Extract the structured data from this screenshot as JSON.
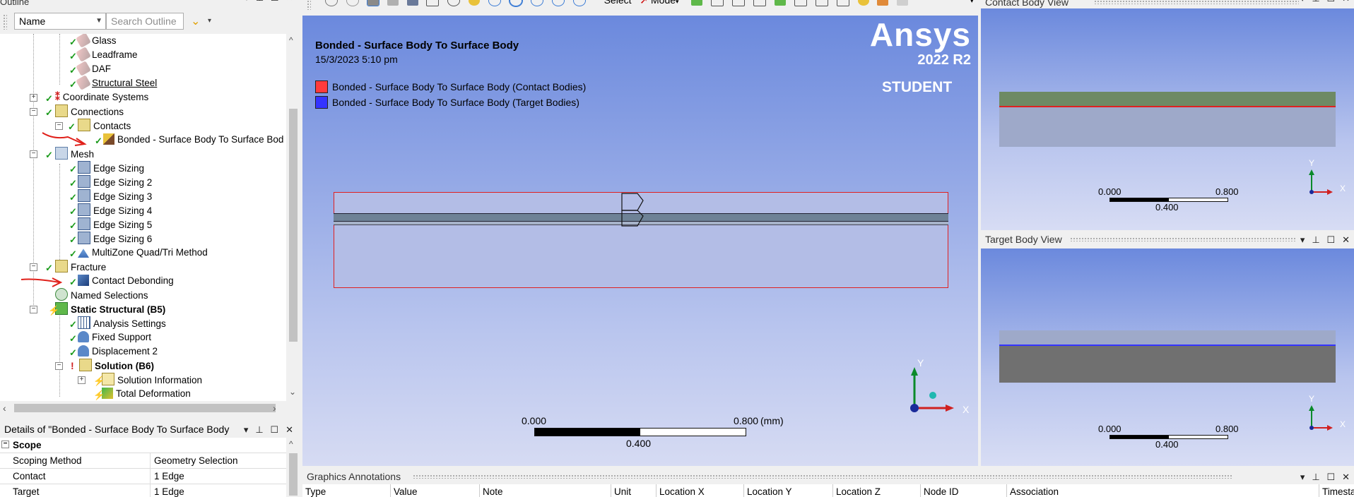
{
  "outline": {
    "title": "Outline",
    "filter_value": "Name",
    "search_placeholder": "Search Outline",
    "tree": [
      {
        "label": "Glass"
      },
      {
        "label": "Leadframe"
      },
      {
        "label": "DAF"
      },
      {
        "label": "Structural Steel"
      },
      {
        "label": "Coordinate Systems"
      },
      {
        "label": "Connections"
      },
      {
        "label": "Contacts"
      },
      {
        "label": "Bonded - Surface Body To Surface Bod"
      },
      {
        "label": "Mesh"
      },
      {
        "label": "Edge Sizing"
      },
      {
        "label": "Edge Sizing 2"
      },
      {
        "label": "Edge Sizing 3"
      },
      {
        "label": "Edge Sizing 4"
      },
      {
        "label": "Edge Sizing 5"
      },
      {
        "label": "Edge Sizing 6"
      },
      {
        "label": "MultiZone Quad/Tri Method"
      },
      {
        "label": "Fracture"
      },
      {
        "label": "Contact Debonding"
      },
      {
        "label": "Named Selections"
      },
      {
        "label": "Static Structural (B5)"
      },
      {
        "label": "Analysis Settings"
      },
      {
        "label": "Fixed Support"
      },
      {
        "label": "Displacement 2"
      },
      {
        "label": "Solution (B6)"
      },
      {
        "label": "Solution Information"
      },
      {
        "label": "Total Deformation"
      }
    ]
  },
  "details": {
    "title": "Details of \"Bonded - Surface Body To Surface Body",
    "section": "Scope",
    "rows": [
      {
        "name": "Scoping Method",
        "value": "Geometry Selection"
      },
      {
        "name": "Contact",
        "value": "1 Edge"
      },
      {
        "name": "Target",
        "value": "1 Edge"
      }
    ]
  },
  "toolbar": {
    "select_label": "Select",
    "mode_label": "Mode"
  },
  "viewport": {
    "title": "Bonded - Surface Body To Surface Body",
    "timestamp": "15/3/2023 5:10 pm",
    "legend": [
      {
        "label": "Bonded - Surface Body To Surface Body (Contact Bodies)",
        "color": "#ff3b3b"
      },
      {
        "label": "Bonded - Surface Body To Surface Body (Target Bodies)",
        "color": "#3434ff"
      }
    ],
    "brand": "Ansys",
    "version": "2022 R2",
    "edition": "STUDENT",
    "scale": {
      "left": "0.000",
      "mid": "0.400",
      "right": "0.800",
      "unit": "(mm)"
    },
    "axis_x": "X",
    "axis_y": "Y"
  },
  "contact_view": {
    "title": "Contact Body View",
    "scale": {
      "left": "0.000",
      "mid": "0.400",
      "right": "0.800"
    },
    "axis_x": "X",
    "axis_y": "Y"
  },
  "target_view": {
    "title": "Target Body View",
    "scale": {
      "left": "0.000",
      "mid": "0.400",
      "right": "0.800"
    },
    "axis_x": "X",
    "axis_y": "Y"
  },
  "annotations": {
    "title": "Graphics Annotations",
    "columns": [
      "Type",
      "Value",
      "Note",
      "Unit",
      "Location X",
      "Location Y",
      "Location Z",
      "Node ID",
      "Association",
      "Timesta"
    ]
  },
  "colors": {
    "contact": "#ff3b3b",
    "target": "#3434ff",
    "check": "#1a9a1a",
    "annotation_arrow": "#e0201a"
  }
}
